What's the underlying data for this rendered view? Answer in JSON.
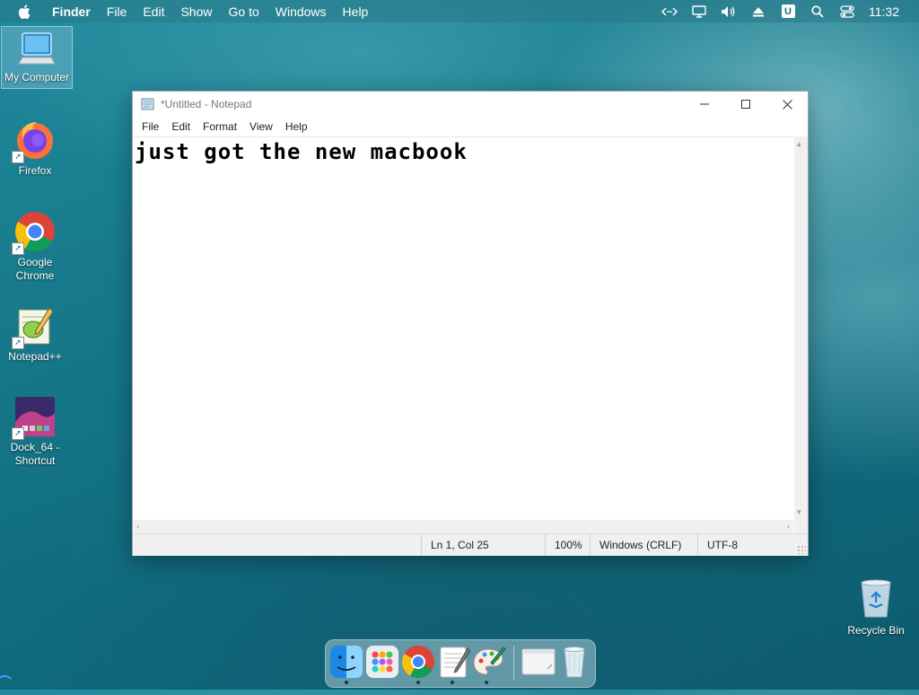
{
  "menubar": {
    "app_name": "Finder",
    "items": [
      "File",
      "Edit",
      "Show",
      "Go to",
      "Windows",
      "Help"
    ],
    "input_badge": "U",
    "clock": "11:32"
  },
  "desktop": {
    "icons": [
      {
        "label": "My Computer"
      },
      {
        "label": "Firefox"
      },
      {
        "label": "Google Chrome"
      },
      {
        "label": "Notepad++"
      },
      {
        "label": "Dock_64 - Shortcut"
      }
    ],
    "recycle_bin": "Recycle Bin"
  },
  "notepad": {
    "title": "*Untitled - Notepad",
    "menu": [
      "File",
      "Edit",
      "Format",
      "View",
      "Help"
    ],
    "content": "just got the new macbook",
    "status": {
      "position": "Ln 1, Col 25",
      "zoom": "100%",
      "line_ending": "Windows (CRLF)",
      "encoding": "UTF-8"
    }
  },
  "colors": {
    "accent": "#1f8a9c",
    "chrome_red": "#db4437",
    "chrome_yellow": "#f4c20d",
    "chrome_green": "#0f9d58",
    "chrome_blue": "#4285f4"
  }
}
